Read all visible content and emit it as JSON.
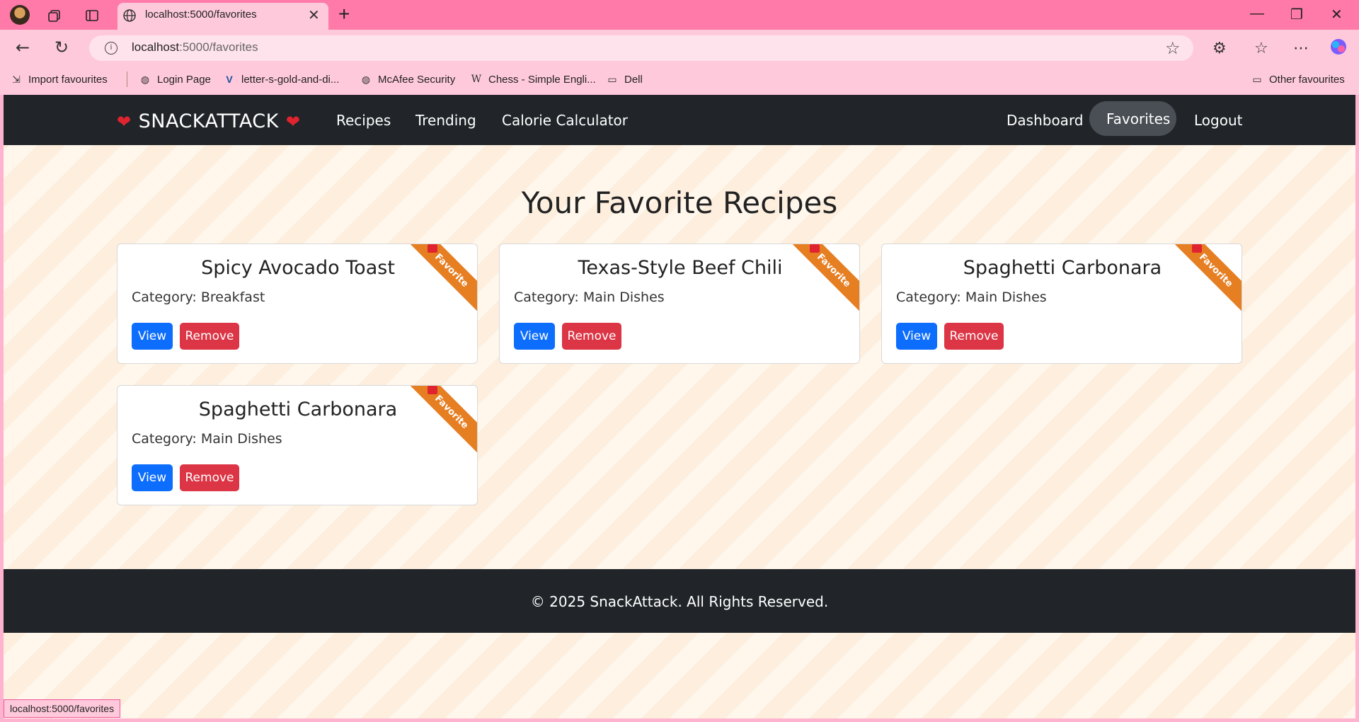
{
  "browser": {
    "tab_title": "localhost:5000/favorites",
    "url_host": "localhost",
    "url_path": ":5000/favorites",
    "bookmarks": [
      {
        "label": "Import favourites",
        "icon": "import-icon"
      },
      {
        "label": "Login Page",
        "icon": "globe-icon"
      },
      {
        "label": "letter-s-gold-and-di...",
        "icon": "vector-icon"
      },
      {
        "label": "McAfee Security",
        "icon": "globe-icon"
      },
      {
        "label": "Chess - Simple Engli...",
        "icon": "wikipedia-icon"
      },
      {
        "label": "Dell",
        "icon": "folder-icon"
      }
    ],
    "other_favourites": "Other favourites",
    "status_url": "localhost:5000/favorites"
  },
  "navbar": {
    "brand": "SNACKATTACK",
    "left_links": [
      "Recipes",
      "Trending",
      "Calorie Calculator"
    ],
    "right_links": [
      "Dashboard",
      "Favorites",
      "Logout"
    ],
    "active": "Favorites"
  },
  "page": {
    "title": "Your Favorite Recipes",
    "ribbon_label": "Favorite",
    "view_label": "View",
    "remove_label": "Remove",
    "cards": [
      {
        "title": "Spicy Avocado Toast",
        "category": "Category: Breakfast"
      },
      {
        "title": "Texas-Style Beef Chili",
        "category": "Category: Main Dishes"
      },
      {
        "title": "Spaghetti Carbonara",
        "category": "Category: Main Dishes"
      },
      {
        "title": "Spaghetti Carbonara",
        "category": "Category: Main Dishes"
      }
    ]
  },
  "footer": {
    "text": "© 2025 SnackAttack. All Rights Reserved."
  },
  "colors": {
    "navbar": "#212529",
    "primary_button": "#0d6efd",
    "danger_button": "#dc3545",
    "ribbon": "#e67e22",
    "browser_tabbar": "#ff7aa8"
  }
}
